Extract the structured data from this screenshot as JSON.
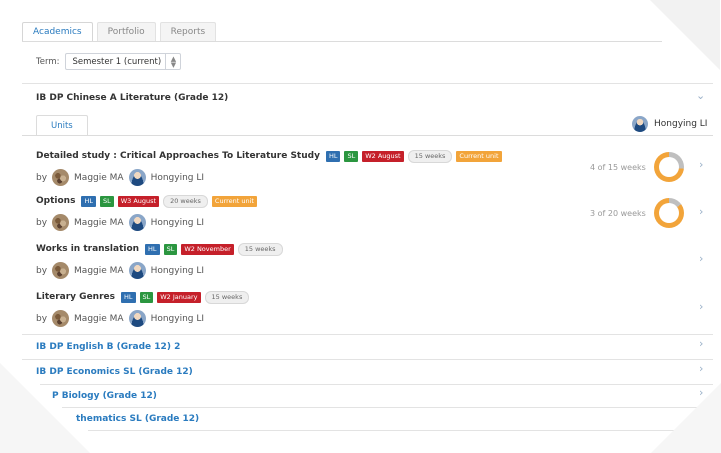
{
  "tabs": [
    "Academics",
    "Portfolio",
    "Reports"
  ],
  "term": {
    "label": "Term:",
    "value": "Semester 1 (current)"
  },
  "main_course": {
    "title": "IB DP Chinese A Literature (Grade 12)",
    "units_tab": "Units",
    "owner": "Hongying LI",
    "units": [
      {
        "title": "Detailed study : Critical Approaches To Literature Study",
        "hl": "HL",
        "sl": "SL",
        "week_badge": "W2 August",
        "weeks": "15 weeks",
        "current": "Current unit",
        "by": "by",
        "teacher1": "Maggie MA",
        "teacher2": "Hongying LI",
        "progress_text": "4 of 15 weeks",
        "progress": 0.27
      },
      {
        "title": "Options",
        "hl": "HL",
        "sl": "SL",
        "week_badge": "W3 August",
        "weeks": "20 weeks",
        "current": "Current unit",
        "by": "by",
        "teacher1": "Maggie MA",
        "teacher2": "Hongying LI",
        "progress_text": "3 of 20 weeks",
        "progress": 0.15
      },
      {
        "title": "Works in translation",
        "hl": "HL",
        "sl": "SL",
        "week_badge": "W2 November",
        "weeks": "15 weeks",
        "by": "by",
        "teacher1": "Maggie MA",
        "teacher2": "Hongying LI"
      },
      {
        "title": "Literary Genres",
        "hl": "HL",
        "sl": "SL",
        "week_badge": "W2 January",
        "weeks": "15 weeks",
        "by": "by",
        "teacher1": "Maggie MA",
        "teacher2": "Hongying LI"
      }
    ]
  },
  "other_courses": [
    "IB DP English B (Grade 12) 2",
    "IB DP Economics SL (Grade 12)",
    "P Biology (Grade 12)",
    "thematics SL (Grade 12)"
  ],
  "colors": {
    "link": "#2a7bbf",
    "hl": "#2f6fb0",
    "sl": "#2b9640",
    "week": "#c5202a",
    "current": "#f2a43a",
    "donut_fill": "#f2a43a",
    "donut_track": "#bfbfbf"
  },
  "icons": {
    "chevron": "chevron-right-icon",
    "collapse": "chevron-down-icon"
  }
}
